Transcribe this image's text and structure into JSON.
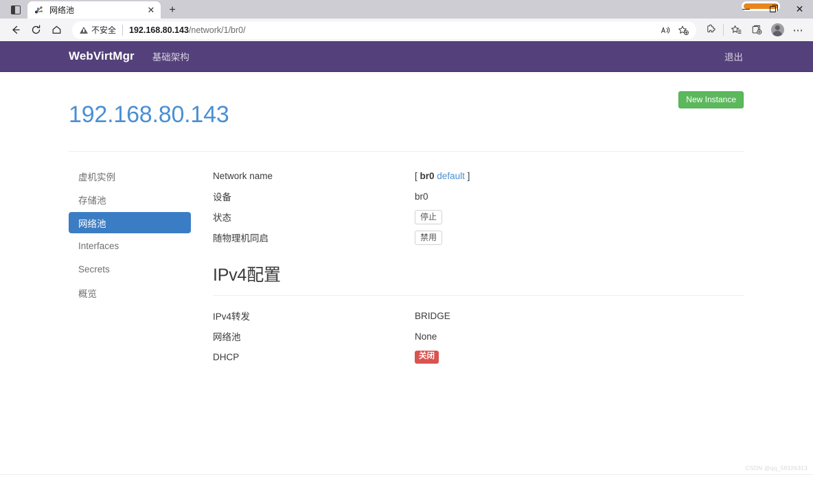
{
  "browser": {
    "tab": {
      "title": "网络池",
      "favicon_name": "site-favicon",
      "close_label": "✕"
    },
    "new_tab_label": "+",
    "nav": {
      "back": "←",
      "refresh": "⟳",
      "home": "⌂"
    },
    "omnibox": {
      "security_label": "不安全",
      "url_host": "192.168.80.143",
      "url_path": "/network/1/br0/",
      "read_aloud": "A",
      "add_favorite": "☆"
    },
    "toolbar_right": {
      "extensions": "⚙",
      "favorites": "☆",
      "collections": "⊞",
      "profile": "avatar",
      "settings": "⋯"
    },
    "window_controls": {
      "minimize": "—",
      "maximize": "❐",
      "close": "✕"
    }
  },
  "app": {
    "navbar": {
      "brand": "WebVirtMgr",
      "links": [
        {
          "label": "基础架构"
        }
      ],
      "logout": "退出"
    },
    "page_title": "192.168.80.143",
    "new_instance_button": "New Instance",
    "sidebar": {
      "items": [
        {
          "label": "虚机实例",
          "active": false
        },
        {
          "label": "存储池",
          "active": false
        },
        {
          "label": "网络池",
          "active": true
        },
        {
          "label": "Interfaces",
          "active": false
        },
        {
          "label": "Secrets",
          "active": false
        },
        {
          "label": "概览",
          "active": false
        }
      ]
    },
    "details": {
      "rows": [
        {
          "label": "Network name",
          "value_prefix": "[ ",
          "value_bold": "br0",
          "value_link": "default",
          "value_suffix": " ]"
        },
        {
          "label": "设备",
          "value": "br0"
        },
        {
          "label": "状态",
          "button": "停止"
        },
        {
          "label": "随物理机同启",
          "button": "禁用"
        }
      ]
    },
    "ipv4_section": {
      "title": "IPv4配置",
      "rows": [
        {
          "label": "IPv4转发",
          "value": "BRIDGE"
        },
        {
          "label": "网络池",
          "value": "None"
        },
        {
          "label": "DHCP",
          "badge": "关闭"
        }
      ]
    },
    "watermark": "CSDN @qq_58326313"
  },
  "colors": {
    "navbar_purple": "#54407a",
    "title_blue": "#4a8fd4",
    "active_blue": "#3b7dc4",
    "green": "#5cb85c",
    "red": "#d9534f"
  }
}
